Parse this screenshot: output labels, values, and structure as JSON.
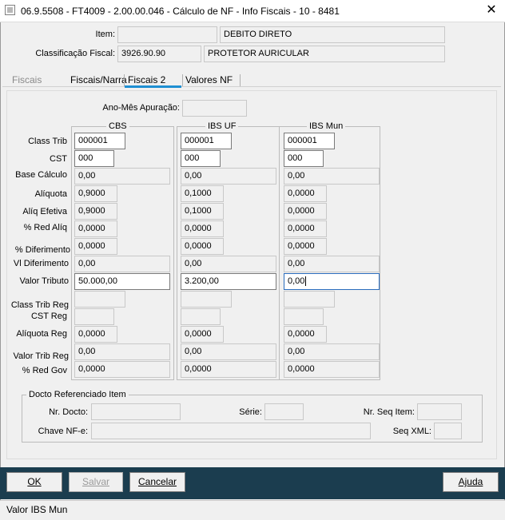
{
  "window": {
    "title": "06.9.5508 - FT4009 - 2.00.00.046 - Cálculo de NF - Info Fiscais - 10 - 8481",
    "close_glyph": "✕"
  },
  "header": {
    "item_label": "Item:",
    "item_code": "",
    "item_desc": "DEBITO DIRETO",
    "class_fiscal_label": "Classificação Fiscal:",
    "class_fiscal_code": "3926.90.90",
    "class_fiscal_desc": "PROTETOR AURICULAR"
  },
  "tabs": [
    {
      "label": "Fiscais"
    },
    {
      "label": "Fiscais/Narra"
    },
    {
      "label": "Fiscais 2"
    },
    {
      "label": "Valores NF"
    }
  ],
  "apuracao": {
    "label": "Ano-Mês Apuração:",
    "value": ""
  },
  "row_labels": {
    "class_trib": "Class Trib",
    "cst": "CST",
    "base_calculo": "Base Cálculo",
    "aliquota": "Alíquota",
    "aliq_efetiva": "Alíq Efetiva",
    "red_aliq": "% Red Alíq",
    "diferimento_pct": "% Diferimento",
    "diferimento_vl": "Vl Diferimento",
    "valor_tributo": "Valor Tributo",
    "class_trib_reg": "Class Trib Reg",
    "cst_reg": "CST Reg",
    "aliquota_reg": "Alíquota Reg",
    "valor_trib_reg": "Valor Trib Reg",
    "red_gov": "% Red Gov"
  },
  "columns": {
    "cbs": {
      "title": "CBS",
      "class_trib": "000001",
      "cst": "000",
      "base_calculo": "0,00",
      "aliquota": "0,9000",
      "aliq_efetiva": "0,9000",
      "red_aliq": "0,0000",
      "diferimento_pct": "0,0000",
      "diferimento_vl": "0,00",
      "valor_tributo": "50.000,00",
      "class_trib_reg": "",
      "cst_reg": "",
      "aliquota_reg": "0,0000",
      "valor_trib_reg": "0,00",
      "red_gov": "0,0000"
    },
    "ibs_uf": {
      "title": "IBS UF",
      "class_trib": "000001",
      "cst": "000",
      "base_calculo": "0,00",
      "aliquota": "0,1000",
      "aliq_efetiva": "0,1000",
      "red_aliq": "0,0000",
      "diferimento_pct": "0,0000",
      "diferimento_vl": "0,00",
      "valor_tributo": "3.200,00",
      "class_trib_reg": "",
      "cst_reg": "",
      "aliquota_reg": "0,0000",
      "valor_trib_reg": "0,00",
      "red_gov": "0,0000"
    },
    "ibs_mun": {
      "title": "IBS Mun",
      "class_trib": "000001",
      "cst": "000",
      "base_calculo": "0,00",
      "aliquota": "0,0000",
      "aliq_efetiva": "0,0000",
      "red_aliq": "0,0000",
      "diferimento_pct": "0,0000",
      "diferimento_vl": "0,00",
      "valor_tributo": "0,00",
      "class_trib_reg": "",
      "cst_reg": "",
      "aliquota_reg": "0,0000",
      "valor_trib_reg": "0,00",
      "red_gov": "0,0000"
    }
  },
  "docto": {
    "title": "Docto Referenciado Item",
    "nr_docto_label": "Nr. Docto:",
    "nr_docto": "",
    "serie_label": "Série:",
    "serie": "",
    "nr_seq_label": "Nr. Seq Item:",
    "nr_seq": "",
    "chave_label": "Chave NF-e:",
    "chave": "",
    "seq_xml_label": "Seq XML:",
    "seq_xml": ""
  },
  "buttons": {
    "ok": "OK",
    "salvar": "Salvar",
    "cancelar": "Cancelar",
    "ajuda": "Ajuda"
  },
  "status": {
    "text": "Valor IBS Mun"
  },
  "colors": {
    "footer": "#1b3d4f",
    "tab_accent": "#1e8fd2",
    "focus_border": "#2a6cbd"
  }
}
